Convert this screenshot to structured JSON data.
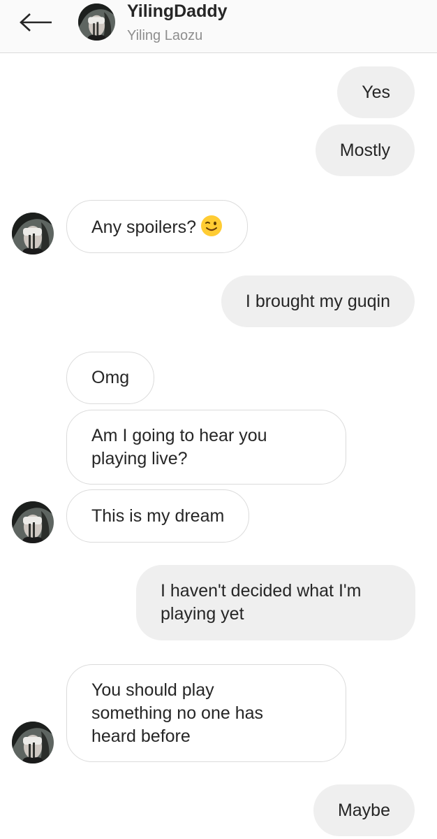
{
  "header": {
    "title": "YilingDaddy",
    "subtitle": "Yiling Laozu"
  },
  "colors": {
    "my_bubble": "#efefef",
    "their_border": "#dbdbdb",
    "subtitle": "#8e8e8e",
    "emoji": "#ffcc33"
  },
  "messages": [
    {
      "from": "me",
      "text": "Yes"
    },
    {
      "from": "me",
      "text": "Mostly"
    },
    {
      "from": "them",
      "text": "Any spoilers?",
      "emoji": "winking-face"
    },
    {
      "from": "me",
      "text": "I brought my guqin"
    },
    {
      "from": "them",
      "text": "Omg"
    },
    {
      "from": "them",
      "text": "Am I going to hear you\nplaying live?"
    },
    {
      "from": "them",
      "text": "This is my dream"
    },
    {
      "from": "me",
      "text": "I haven't decided what I'm\nplaying yet"
    },
    {
      "from": "them",
      "text": "You should play\nsomething no one has\nheard before"
    },
    {
      "from": "me",
      "text": "Maybe"
    }
  ]
}
